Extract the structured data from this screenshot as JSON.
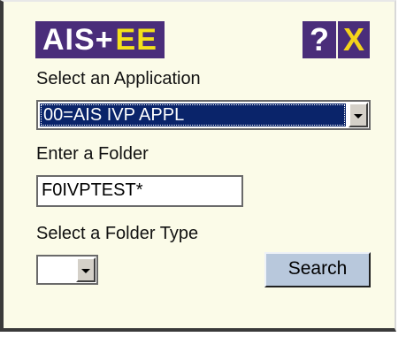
{
  "header": {
    "logo_text_ais": "AIS+",
    "logo_text_ee": "EE",
    "help_label": "?",
    "close_label": "X"
  },
  "form": {
    "application_label": "Select an Application",
    "application_value": "00=AIS IVP APPL",
    "folder_label": "Enter a Folder",
    "folder_value": "F0IVPTEST*",
    "folder_type_label": "Select a Folder Type",
    "folder_type_value": "",
    "search_label": "Search"
  },
  "colors": {
    "panel_bg": "#fbfbe8",
    "logo_bg": "#4a2d7a",
    "logo_accent": "#f4e21a",
    "selection_bg": "#0a246a",
    "search_button_bg": "#b8c8dc"
  }
}
